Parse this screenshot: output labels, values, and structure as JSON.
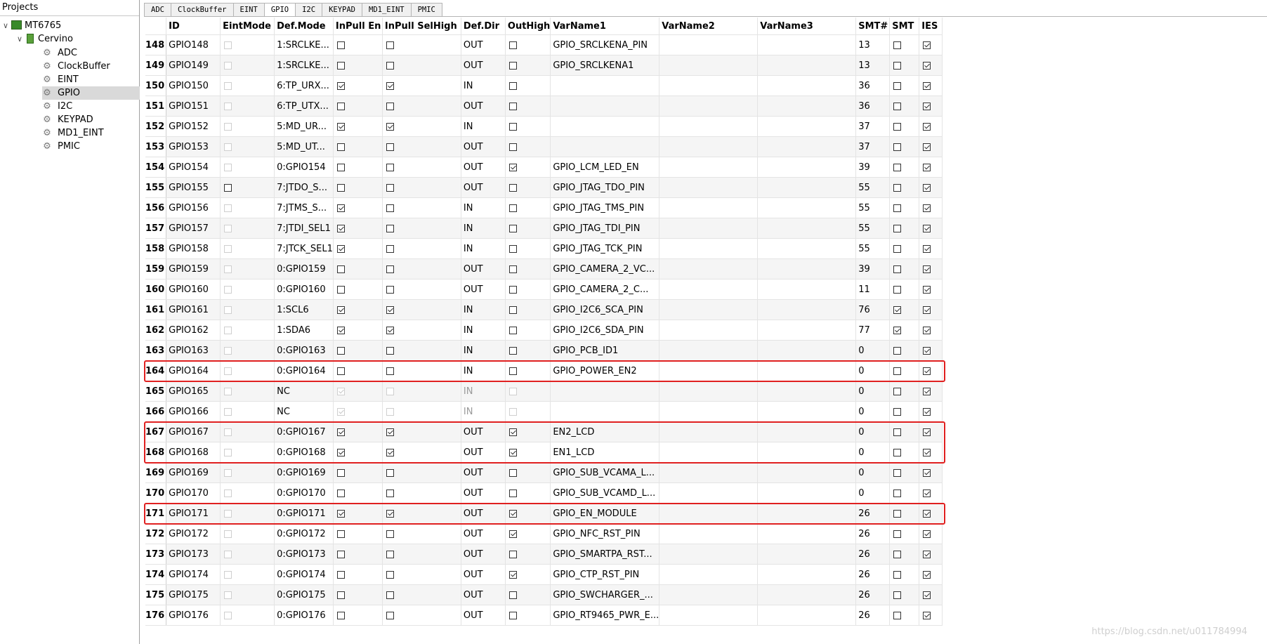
{
  "tree": {
    "header": "Projects",
    "chip": "MT6765",
    "board": "Cervino",
    "items": [
      "ADC",
      "ClockBuffer",
      "EINT",
      "GPIO",
      "I2C",
      "KEYPAD",
      "MD1_EINT",
      "PMIC"
    ],
    "selected": "GPIO"
  },
  "tabs": [
    "ADC",
    "ClockBuffer",
    "EINT",
    "GPIO",
    "I2C",
    "KEYPAD",
    "MD1_EINT",
    "PMIC"
  ],
  "active_tab": "GPIO",
  "columns": [
    "ID",
    "EintMode",
    "Def.Mode",
    "InPull En",
    "InPull SelHigh",
    "Def.Dir",
    "OutHigh",
    "VarName1",
    "VarName2",
    "VarName3",
    "SMT#",
    "SMT",
    "IES"
  ],
  "rows": [
    {
      "n": "148",
      "id": "GPIO148",
      "eint": false,
      "eint_dis": true,
      "mode": "1:SRCLKE...",
      "pe": false,
      "sh": false,
      "dir": "OUT",
      "oh": false,
      "v1": "GPIO_SRCLKENA_PIN",
      "v2": "",
      "v3": "",
      "smtn": "13",
      "smt": false,
      "ies": true
    },
    {
      "n": "149",
      "id": "GPIO149",
      "eint": false,
      "eint_dis": true,
      "mode": "1:SRCLKE...",
      "pe": false,
      "sh": false,
      "dir": "OUT",
      "oh": false,
      "v1": "GPIO_SRCLKENA1",
      "v2": "",
      "v3": "",
      "smtn": "13",
      "smt": false,
      "ies": true
    },
    {
      "n": "150",
      "id": "GPIO150",
      "eint": false,
      "eint_dis": true,
      "mode": "6:TP_URX...",
      "pe": true,
      "sh": true,
      "dir": "IN",
      "oh": false,
      "v1": "",
      "v2": "",
      "v3": "",
      "smtn": "36",
      "smt": false,
      "ies": true
    },
    {
      "n": "151",
      "id": "GPIO151",
      "eint": false,
      "eint_dis": true,
      "mode": "6:TP_UTX...",
      "pe": false,
      "sh": false,
      "dir": "OUT",
      "oh": false,
      "v1": "",
      "v2": "",
      "v3": "",
      "smtn": "36",
      "smt": false,
      "ies": true
    },
    {
      "n": "152",
      "id": "GPIO152",
      "eint": false,
      "eint_dis": true,
      "mode": "5:MD_UR...",
      "pe": true,
      "sh": true,
      "dir": "IN",
      "oh": false,
      "v1": "",
      "v2": "",
      "v3": "",
      "smtn": "37",
      "smt": false,
      "ies": true
    },
    {
      "n": "153",
      "id": "GPIO153",
      "eint": false,
      "eint_dis": true,
      "mode": "5:MD_UT...",
      "pe": false,
      "sh": false,
      "dir": "OUT",
      "oh": false,
      "v1": "",
      "v2": "",
      "v3": "",
      "smtn": "37",
      "smt": false,
      "ies": true
    },
    {
      "n": "154",
      "id": "GPIO154",
      "eint": false,
      "eint_dis": true,
      "mode": "0:GPIO154",
      "pe": false,
      "sh": false,
      "dir": "OUT",
      "oh": true,
      "v1": "GPIO_LCM_LED_EN",
      "v2": "",
      "v3": "",
      "smtn": "39",
      "smt": false,
      "ies": true
    },
    {
      "n": "155",
      "id": "GPIO155",
      "eint": false,
      "eint_dis": false,
      "mode": "7:JTDO_S...",
      "pe": false,
      "sh": false,
      "dir": "OUT",
      "oh": false,
      "v1": "GPIO_JTAG_TDO_PIN",
      "v2": "",
      "v3": "",
      "smtn": "55",
      "smt": false,
      "ies": true
    },
    {
      "n": "156",
      "id": "GPIO156",
      "eint": false,
      "eint_dis": true,
      "mode": "7:JTMS_S...",
      "pe": true,
      "sh": false,
      "dir": "IN",
      "oh": false,
      "v1": "GPIO_JTAG_TMS_PIN",
      "v2": "",
      "v3": "",
      "smtn": "55",
      "smt": false,
      "ies": true
    },
    {
      "n": "157",
      "id": "GPIO157",
      "eint": false,
      "eint_dis": true,
      "mode": "7:JTDI_SEL1",
      "pe": true,
      "sh": false,
      "dir": "IN",
      "oh": false,
      "v1": "GPIO_JTAG_TDI_PIN",
      "v2": "",
      "v3": "",
      "smtn": "55",
      "smt": false,
      "ies": true
    },
    {
      "n": "158",
      "id": "GPIO158",
      "eint": false,
      "eint_dis": true,
      "mode": "7:JTCK_SEL1",
      "pe": true,
      "sh": false,
      "dir": "IN",
      "oh": false,
      "v1": "GPIO_JTAG_TCK_PIN",
      "v2": "",
      "v3": "",
      "smtn": "55",
      "smt": false,
      "ies": true
    },
    {
      "n": "159",
      "id": "GPIO159",
      "eint": false,
      "eint_dis": true,
      "mode": "0:GPIO159",
      "pe": false,
      "sh": false,
      "dir": "OUT",
      "oh": false,
      "v1": "GPIO_CAMERA_2_VC...",
      "v2": "",
      "v3": "",
      "smtn": "39",
      "smt": false,
      "ies": true
    },
    {
      "n": "160",
      "id": "GPIO160",
      "eint": false,
      "eint_dis": true,
      "mode": "0:GPIO160",
      "pe": false,
      "sh": false,
      "dir": "OUT",
      "oh": false,
      "v1": "GPIO_CAMERA_2_C...",
      "v2": "",
      "v3": "",
      "smtn": "11",
      "smt": false,
      "ies": true
    },
    {
      "n": "161",
      "id": "GPIO161",
      "eint": false,
      "eint_dis": true,
      "mode": "1:SCL6",
      "pe": true,
      "sh": true,
      "dir": "IN",
      "oh": false,
      "v1": "GPIO_I2C6_SCA_PIN",
      "v2": "",
      "v3": "",
      "smtn": "76",
      "smt": true,
      "ies": true
    },
    {
      "n": "162",
      "id": "GPIO162",
      "eint": false,
      "eint_dis": true,
      "mode": "1:SDA6",
      "pe": true,
      "sh": true,
      "dir": "IN",
      "oh": false,
      "v1": "GPIO_I2C6_SDA_PIN",
      "v2": "",
      "v3": "",
      "smtn": "77",
      "smt": true,
      "ies": true
    },
    {
      "n": "163",
      "id": "GPIO163",
      "eint": false,
      "eint_dis": true,
      "mode": "0:GPIO163",
      "pe": false,
      "sh": false,
      "dir": "IN",
      "oh": false,
      "v1": "GPIO_PCB_ID1",
      "v2": "",
      "v3": "",
      "smtn": "0",
      "smt": false,
      "ies": true
    },
    {
      "n": "164",
      "id": "GPIO164",
      "eint": false,
      "eint_dis": true,
      "mode": "0:GPIO164",
      "pe": false,
      "sh": false,
      "dir": "IN",
      "oh": false,
      "v1": "GPIO_POWER_EN2",
      "v2": "",
      "v3": "",
      "smtn": "0",
      "smt": false,
      "ies": true
    },
    {
      "n": "165",
      "id": "GPIO165",
      "eint": false,
      "eint_dis": true,
      "mode": "NC",
      "pe": true,
      "sh": false,
      "dir": "IN",
      "oh": false,
      "v1": "",
      "v2": "",
      "v3": "",
      "smtn": "0",
      "smt": false,
      "ies": true,
      "nc": true
    },
    {
      "n": "166",
      "id": "GPIO166",
      "eint": false,
      "eint_dis": true,
      "mode": "NC",
      "pe": true,
      "sh": false,
      "dir": "IN",
      "oh": false,
      "v1": "",
      "v2": "",
      "v3": "",
      "smtn": "0",
      "smt": false,
      "ies": true,
      "nc": true
    },
    {
      "n": "167",
      "id": "GPIO167",
      "eint": false,
      "eint_dis": true,
      "mode": "0:GPIO167",
      "pe": true,
      "sh": true,
      "dir": "OUT",
      "oh": true,
      "v1": "EN2_LCD",
      "v2": "",
      "v3": "",
      "smtn": "0",
      "smt": false,
      "ies": true
    },
    {
      "n": "168",
      "id": "GPIO168",
      "eint": false,
      "eint_dis": true,
      "mode": "0:GPIO168",
      "pe": true,
      "sh": true,
      "dir": "OUT",
      "oh": true,
      "v1": "EN1_LCD",
      "v2": "",
      "v3": "",
      "smtn": "0",
      "smt": false,
      "ies": true
    },
    {
      "n": "169",
      "id": "GPIO169",
      "eint": false,
      "eint_dis": true,
      "mode": "0:GPIO169",
      "pe": false,
      "sh": false,
      "dir": "OUT",
      "oh": false,
      "v1": "GPIO_SUB_VCAMA_L...",
      "v2": "",
      "v3": "",
      "smtn": "0",
      "smt": false,
      "ies": true
    },
    {
      "n": "170",
      "id": "GPIO170",
      "eint": false,
      "eint_dis": true,
      "mode": "0:GPIO170",
      "pe": false,
      "sh": false,
      "dir": "OUT",
      "oh": false,
      "v1": "GPIO_SUB_VCAMD_L...",
      "v2": "",
      "v3": "",
      "smtn": "0",
      "smt": false,
      "ies": true
    },
    {
      "n": "171",
      "id": "GPIO171",
      "eint": false,
      "eint_dis": true,
      "mode": "0:GPIO171",
      "pe": true,
      "sh": true,
      "dir": "OUT",
      "oh": true,
      "v1": "GPIO_EN_MODULE",
      "v2": "",
      "v3": "",
      "smtn": "26",
      "smt": false,
      "ies": true
    },
    {
      "n": "172",
      "id": "GPIO172",
      "eint": false,
      "eint_dis": true,
      "mode": "0:GPIO172",
      "pe": false,
      "sh": false,
      "dir": "OUT",
      "oh": true,
      "v1": "GPIO_NFC_RST_PIN",
      "v2": "",
      "v3": "",
      "smtn": "26",
      "smt": false,
      "ies": true
    },
    {
      "n": "173",
      "id": "GPIO173",
      "eint": false,
      "eint_dis": true,
      "mode": "0:GPIO173",
      "pe": false,
      "sh": false,
      "dir": "OUT",
      "oh": false,
      "v1": "GPIO_SMARTPA_RST...",
      "v2": "",
      "v3": "",
      "smtn": "26",
      "smt": false,
      "ies": true
    },
    {
      "n": "174",
      "id": "GPIO174",
      "eint": false,
      "eint_dis": true,
      "mode": "0:GPIO174",
      "pe": false,
      "sh": false,
      "dir": "OUT",
      "oh": true,
      "v1": "GPIO_CTP_RST_PIN",
      "v2": "",
      "v3": "",
      "smtn": "26",
      "smt": false,
      "ies": true
    },
    {
      "n": "175",
      "id": "GPIO175",
      "eint": false,
      "eint_dis": true,
      "mode": "0:GPIO175",
      "pe": false,
      "sh": false,
      "dir": "OUT",
      "oh": false,
      "v1": "GPIO_SWCHARGER_...",
      "v2": "",
      "v3": "",
      "smtn": "26",
      "smt": false,
      "ies": true
    },
    {
      "n": "176",
      "id": "GPIO176",
      "eint": false,
      "eint_dis": true,
      "mode": "0:GPIO176",
      "pe": false,
      "sh": false,
      "dir": "OUT",
      "oh": false,
      "v1": "GPIO_RT9465_PWR_E...",
      "v2": "",
      "v3": "",
      "smtn": "26",
      "smt": false,
      "ies": true
    }
  ],
  "highlight_groups": [
    [
      "164"
    ],
    [
      "167",
      "168"
    ],
    [
      "171"
    ]
  ],
  "highlight_color": "#e02020",
  "watermark": "https://blog.csdn.net/u011784994"
}
